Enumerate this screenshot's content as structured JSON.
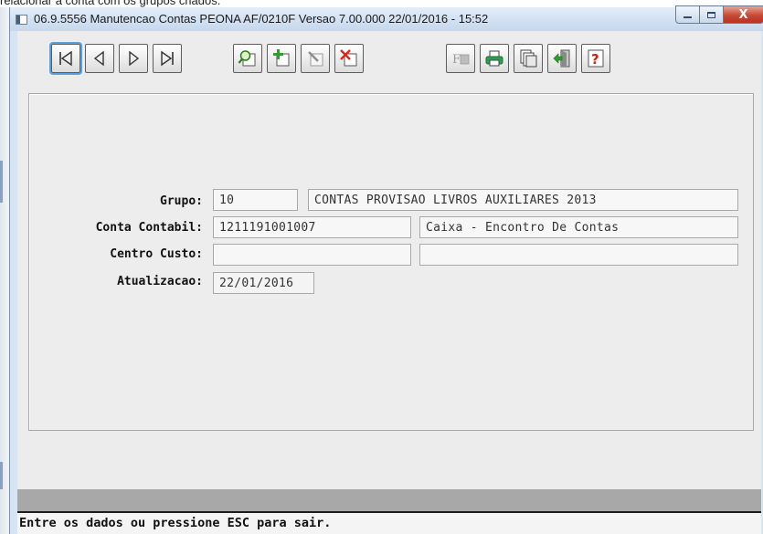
{
  "top_caption": "relacionar a conta com os grupos criados.",
  "window": {
    "title": "06.9.5556 Manutencao Contas PEONA AF/0210F Versao 7.00.000 22/01/2016 - 15:52",
    "minimize_icon": "minimize-icon",
    "maximize_icon": "maximize-icon",
    "close_label": "X"
  },
  "toolbar": {
    "buttons": [
      {
        "icon": "first-record-icon"
      },
      {
        "icon": "previous-record-icon"
      },
      {
        "icon": "next-record-icon"
      },
      {
        "icon": "last-record-icon"
      },
      {
        "icon": "search-icon"
      },
      {
        "icon": "add-record-icon"
      },
      {
        "icon": "edit-record-icon"
      },
      {
        "icon": "delete-record-icon"
      },
      {
        "icon": "filter-icon"
      },
      {
        "icon": "print-icon"
      },
      {
        "icon": "copy-icon"
      },
      {
        "icon": "exit-icon"
      },
      {
        "icon": "help-icon"
      }
    ]
  },
  "form": {
    "grupo": {
      "label": "Grupo:",
      "code": "10",
      "description": "CONTAS PROVISAO LIVROS AUXILIARES 2013"
    },
    "conta_contabil": {
      "label": "Conta Contabil:",
      "code": "1211191001007",
      "description": "Caixa - Encontro De Contas"
    },
    "centro_custo": {
      "label": "Centro Custo:",
      "code": "",
      "description": ""
    },
    "atualizacao": {
      "label": "Atualizacao:",
      "value": "22/01/2016"
    }
  },
  "status": {
    "message": "Entre os dados ou pressione ESC para sair."
  }
}
